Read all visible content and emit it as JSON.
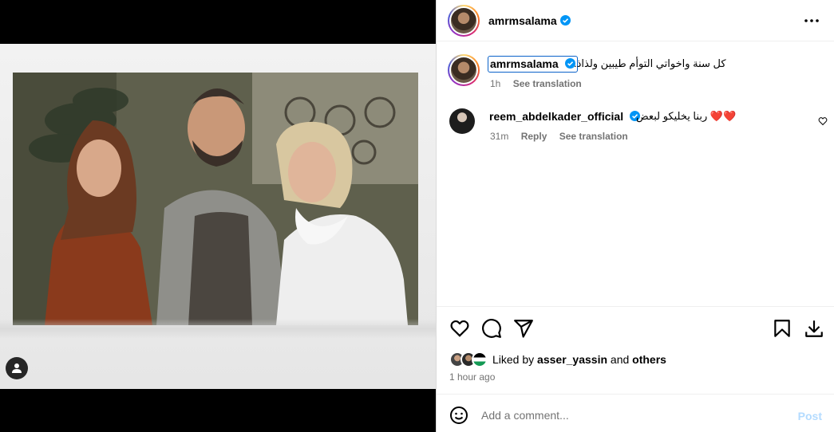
{
  "post": {
    "author": "amrmsalama",
    "caption_author": "amrmsalama",
    "caption_text": "كل سنة واخواتي التوأم طيبين ولذاذ.",
    "caption_time": "1h",
    "see_translation": "See translation",
    "comments": [
      {
        "user": "reem_abdelkader_official",
        "text": "ربنا يخليكو لبعض ❤️❤️",
        "time": "31m",
        "reply": "Reply",
        "see_translation": "See translation"
      }
    ],
    "liked_by_prefix": "Liked by",
    "liked_by_user": "asser_yassin",
    "liked_by_and": "and",
    "liked_by_others": "others",
    "time_ago": "1 hour ago"
  },
  "comment_box": {
    "placeholder": "Add a comment...",
    "post_label": "Post"
  },
  "colors": {
    "verified": "#0095f6",
    "post_disabled": "#b3dbff",
    "focus_outline": "#0a62c9"
  },
  "icons": [
    "user-tag-icon",
    "more-options-icon",
    "verified-icon",
    "heart-icon",
    "comment-icon",
    "share-icon",
    "save-icon",
    "download-icon",
    "emoji-icon"
  ]
}
